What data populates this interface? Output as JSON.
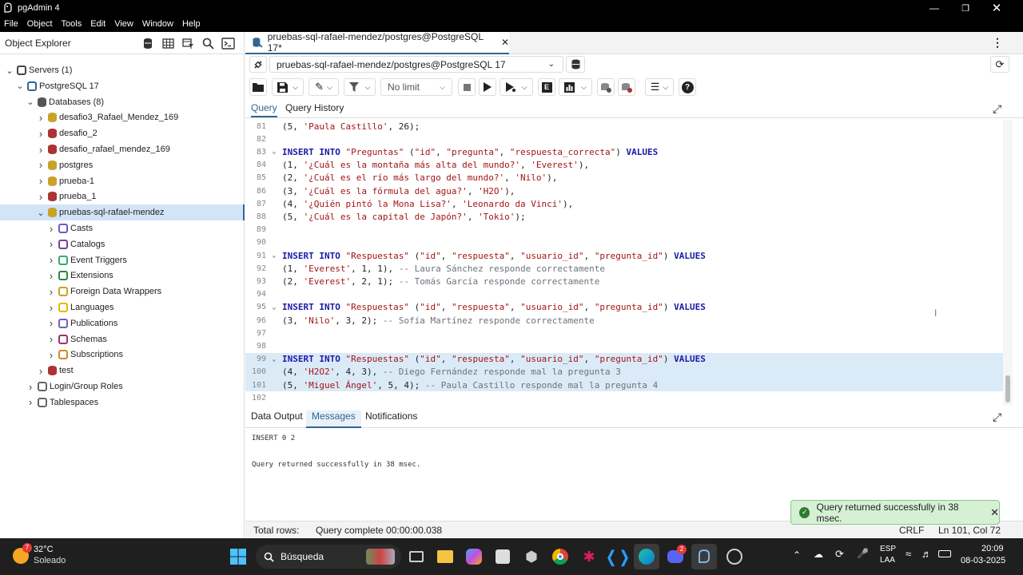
{
  "window": {
    "title": "pgAdmin 4"
  },
  "menu": [
    "File",
    "Object",
    "Tools",
    "Edit",
    "View",
    "Window",
    "Help"
  ],
  "object_explorer": {
    "title": "Object Explorer",
    "tree": [
      {
        "label": "Servers (1)",
        "level": 0,
        "expanded": true,
        "icon": "servers-icon"
      },
      {
        "label": "PostgreSQL 17",
        "level": 1,
        "expanded": true,
        "icon": "server-icon"
      },
      {
        "label": "Databases (8)",
        "level": 2,
        "expanded": true,
        "icon": "databases-icon"
      },
      {
        "label": "desafio3_Rafael_Mendez_169",
        "level": 3,
        "expanded": false,
        "icon": "database-icon"
      },
      {
        "label": "desafio_2",
        "level": 3,
        "expanded": false,
        "icon": "database-disconnected-icon"
      },
      {
        "label": "desafio_rafael_mendez_169",
        "level": 3,
        "expanded": false,
        "icon": "database-disconnected-icon"
      },
      {
        "label": "postgres",
        "level": 3,
        "expanded": false,
        "icon": "database-icon"
      },
      {
        "label": "prueba-1",
        "level": 3,
        "expanded": false,
        "icon": "database-icon"
      },
      {
        "label": "prueba_1",
        "level": 3,
        "expanded": false,
        "icon": "database-disconnected-icon"
      },
      {
        "label": "pruebas-sql-rafael-mendez",
        "level": 3,
        "expanded": true,
        "selected": true,
        "icon": "database-icon"
      },
      {
        "label": "Casts",
        "level": 4,
        "expanded": false,
        "icon": "casts-icon"
      },
      {
        "label": "Catalogs",
        "level": 4,
        "expanded": false,
        "icon": "catalogs-icon"
      },
      {
        "label": "Event Triggers",
        "level": 4,
        "expanded": false,
        "icon": "event-triggers-icon"
      },
      {
        "label": "Extensions",
        "level": 4,
        "expanded": false,
        "icon": "extensions-icon"
      },
      {
        "label": "Foreign Data Wrappers",
        "level": 4,
        "expanded": false,
        "icon": "foreign-data-wrappers-icon"
      },
      {
        "label": "Languages",
        "level": 4,
        "expanded": false,
        "icon": "languages-icon"
      },
      {
        "label": "Publications",
        "level": 4,
        "expanded": false,
        "icon": "publications-icon"
      },
      {
        "label": "Schemas",
        "level": 4,
        "expanded": false,
        "icon": "schemas-icon"
      },
      {
        "label": "Subscriptions",
        "level": 4,
        "expanded": false,
        "icon": "subscriptions-icon"
      },
      {
        "label": "test",
        "level": 3,
        "expanded": false,
        "icon": "database-disconnected-icon"
      },
      {
        "label": "Login/Group Roles",
        "level": 2,
        "expanded": false,
        "icon": "roles-icon"
      },
      {
        "label": "Tablespaces",
        "level": 2,
        "expanded": false,
        "icon": "tablespaces-icon"
      }
    ]
  },
  "query_tool": {
    "tab_label": "pruebas-sql-rafael-mendez/postgres@PostgreSQL 17*",
    "connection": "pruebas-sql-rafael-mendez/postgres@PostgreSQL 17",
    "limit": "No limit",
    "subtabs": [
      "Query",
      "Query History"
    ],
    "lines": [
      {
        "n": "81",
        "fold": false,
        "hl": false,
        "tokens": [
          [
            "p",
            "("
          ],
          [
            "num",
            "5"
          ],
          [
            "p",
            ", "
          ],
          [
            "str",
            "'Paula Castillo'"
          ],
          [
            "p",
            ", "
          ],
          [
            "num",
            "26"
          ],
          [
            "p",
            ");"
          ]
        ]
      },
      {
        "n": "82",
        "fold": false,
        "hl": false,
        "tokens": []
      },
      {
        "n": "83",
        "fold": true,
        "hl": false,
        "tokens": [
          [
            "kw",
            "INSERT INTO "
          ],
          [
            "str",
            "\"Preguntas\""
          ],
          [
            "p",
            " ("
          ],
          [
            "str",
            "\"id\""
          ],
          [
            "p",
            ", "
          ],
          [
            "str",
            "\"pregunta\""
          ],
          [
            "p",
            ", "
          ],
          [
            "str",
            "\"respuesta_correcta\""
          ],
          [
            "p",
            ") "
          ],
          [
            "kw",
            "VALUES"
          ]
        ]
      },
      {
        "n": "84",
        "fold": false,
        "hl": false,
        "tokens": [
          [
            "p",
            "("
          ],
          [
            "num",
            "1"
          ],
          [
            "p",
            ", "
          ],
          [
            "str",
            "'¿Cuál es la montaña más alta del mundo?'"
          ],
          [
            "p",
            ", "
          ],
          [
            "str",
            "'Everest'"
          ],
          [
            "p",
            "),"
          ]
        ]
      },
      {
        "n": "85",
        "fold": false,
        "hl": false,
        "tokens": [
          [
            "p",
            "("
          ],
          [
            "num",
            "2"
          ],
          [
            "p",
            ", "
          ],
          [
            "str",
            "'¿Cuál es el río más largo del mundo?'"
          ],
          [
            "p",
            ", "
          ],
          [
            "str",
            "'Nilo'"
          ],
          [
            "p",
            "),"
          ]
        ]
      },
      {
        "n": "86",
        "fold": false,
        "hl": false,
        "tokens": [
          [
            "p",
            "("
          ],
          [
            "num",
            "3"
          ],
          [
            "p",
            ", "
          ],
          [
            "str",
            "'¿Cuál es la fórmula del agua?'"
          ],
          [
            "p",
            ", "
          ],
          [
            "str",
            "'H2O'"
          ],
          [
            "p",
            "),"
          ]
        ]
      },
      {
        "n": "87",
        "fold": false,
        "hl": false,
        "tokens": [
          [
            "p",
            "("
          ],
          [
            "num",
            "4"
          ],
          [
            "p",
            ", "
          ],
          [
            "str",
            "'¿Quién pintó la Mona Lisa?'"
          ],
          [
            "p",
            ", "
          ],
          [
            "str",
            "'Leonardo da Vinci'"
          ],
          [
            "p",
            "),"
          ]
        ]
      },
      {
        "n": "88",
        "fold": false,
        "hl": false,
        "tokens": [
          [
            "p",
            "("
          ],
          [
            "num",
            "5"
          ],
          [
            "p",
            ", "
          ],
          [
            "str",
            "'¿Cuál es la capital de Japón?'"
          ],
          [
            "p",
            ", "
          ],
          [
            "str",
            "'Tokio'"
          ],
          [
            "p",
            ");"
          ]
        ]
      },
      {
        "n": "89",
        "fold": false,
        "hl": false,
        "tokens": []
      },
      {
        "n": "90",
        "fold": false,
        "hl": false,
        "tokens": []
      },
      {
        "n": "91",
        "fold": true,
        "hl": false,
        "tokens": [
          [
            "kw",
            "INSERT INTO "
          ],
          [
            "str",
            "\"Respuestas\""
          ],
          [
            "p",
            " ("
          ],
          [
            "str",
            "\"id\""
          ],
          [
            "p",
            ", "
          ],
          [
            "str",
            "\"respuesta\""
          ],
          [
            "p",
            ", "
          ],
          [
            "str",
            "\"usuario_id\""
          ],
          [
            "p",
            ", "
          ],
          [
            "str",
            "\"pregunta_id\""
          ],
          [
            "p",
            ") "
          ],
          [
            "kw",
            "VALUES"
          ]
        ]
      },
      {
        "n": "92",
        "fold": false,
        "hl": false,
        "tokens": [
          [
            "p",
            "("
          ],
          [
            "num",
            "1"
          ],
          [
            "p",
            ", "
          ],
          [
            "str",
            "'Everest'"
          ],
          [
            "p",
            ", "
          ],
          [
            "num",
            "1"
          ],
          [
            "p",
            ", "
          ],
          [
            "num",
            "1"
          ],
          [
            "p",
            "), "
          ],
          [
            "cmt",
            "-- Laura Sánchez responde correctamente"
          ]
        ]
      },
      {
        "n": "93",
        "fold": false,
        "hl": false,
        "tokens": [
          [
            "p",
            "("
          ],
          [
            "num",
            "2"
          ],
          [
            "p",
            ", "
          ],
          [
            "str",
            "'Everest'"
          ],
          [
            "p",
            ", "
          ],
          [
            "num",
            "2"
          ],
          [
            "p",
            ", "
          ],
          [
            "num",
            "1"
          ],
          [
            "p",
            "); "
          ],
          [
            "cmt",
            "-- Tomás García responde correctamente"
          ]
        ]
      },
      {
        "n": "94",
        "fold": false,
        "hl": false,
        "tokens": []
      },
      {
        "n": "95",
        "fold": true,
        "hl": false,
        "tokens": [
          [
            "kw",
            "INSERT INTO "
          ],
          [
            "str",
            "\"Respuestas\""
          ],
          [
            "p",
            " ("
          ],
          [
            "str",
            "\"id\""
          ],
          [
            "p",
            ", "
          ],
          [
            "str",
            "\"respuesta\""
          ],
          [
            "p",
            ", "
          ],
          [
            "str",
            "\"usuario_id\""
          ],
          [
            "p",
            ", "
          ],
          [
            "str",
            "\"pregunta_id\""
          ],
          [
            "p",
            ") "
          ],
          [
            "kw",
            "VALUES"
          ]
        ]
      },
      {
        "n": "96",
        "fold": false,
        "hl": false,
        "tokens": [
          [
            "p",
            "("
          ],
          [
            "num",
            "3"
          ],
          [
            "p",
            ", "
          ],
          [
            "str",
            "'Nilo'"
          ],
          [
            "p",
            ", "
          ],
          [
            "num",
            "3"
          ],
          [
            "p",
            ", "
          ],
          [
            "num",
            "2"
          ],
          [
            "p",
            "); "
          ],
          [
            "cmt",
            "-- Sofía Martínez responde correctamente"
          ]
        ]
      },
      {
        "n": "97",
        "fold": false,
        "hl": false,
        "tokens": []
      },
      {
        "n": "98",
        "fold": false,
        "hl": false,
        "tokens": []
      },
      {
        "n": "99",
        "fold": true,
        "hl": true,
        "tokens": [
          [
            "kw",
            "INSERT INTO "
          ],
          [
            "str",
            "\"Respuestas\""
          ],
          [
            "p",
            " ("
          ],
          [
            "str",
            "\"id\""
          ],
          [
            "p",
            ", "
          ],
          [
            "str",
            "\"respuesta\""
          ],
          [
            "p",
            ", "
          ],
          [
            "str",
            "\"usuario_id\""
          ],
          [
            "p",
            ", "
          ],
          [
            "str",
            "\"pregunta_id\""
          ],
          [
            "p",
            ") "
          ],
          [
            "kw",
            "VALUES"
          ]
        ]
      },
      {
        "n": "100",
        "fold": false,
        "hl": true,
        "tokens": [
          [
            "p",
            "("
          ],
          [
            "num",
            "4"
          ],
          [
            "p",
            ", "
          ],
          [
            "str",
            "'H2O2'"
          ],
          [
            "p",
            ", "
          ],
          [
            "num",
            "4"
          ],
          [
            "p",
            ", "
          ],
          [
            "num",
            "3"
          ],
          [
            "p",
            "), "
          ],
          [
            "cmt",
            "-- Diego Fernández responde mal la pregunta 3"
          ]
        ]
      },
      {
        "n": "101",
        "fold": false,
        "hl": true,
        "tokens": [
          [
            "p",
            "("
          ],
          [
            "num",
            "5"
          ],
          [
            "p",
            ", "
          ],
          [
            "str",
            "'Miguel Ángel'"
          ],
          [
            "p",
            ", "
          ],
          [
            "num",
            "5"
          ],
          [
            "p",
            ", "
          ],
          [
            "num",
            "4"
          ],
          [
            "p",
            "); "
          ],
          [
            "cmt",
            "-- Paula Castillo responde mal la pregunta 4"
          ]
        ]
      },
      {
        "n": "102",
        "fold": false,
        "hl": false,
        "tokens": []
      }
    ]
  },
  "output": {
    "tabs": [
      "Data Output",
      "Messages",
      "Notifications"
    ],
    "active_tab": "Messages",
    "messages": [
      "INSERT 0 2",
      "Query returned successfully in 38 msec."
    ]
  },
  "status": {
    "total_rows": "Total rows:",
    "query_complete": "Query complete 00:00:00.038",
    "eol": "CRLF",
    "position": "Ln 101, Col 72"
  },
  "toast": {
    "message": "Query returned successfully in 38 msec."
  },
  "taskbar": {
    "weather_temp": "32°C",
    "weather_desc": "Soleado",
    "weather_badge": "7",
    "search_placeholder": "Búsqueda",
    "lang1": "ESP",
    "lang2": "LAA",
    "time": "20:09",
    "date": "08-03-2025",
    "discord_badge": "2"
  },
  "colors": {
    "accent": "#326690",
    "selected": "#d3e4f7",
    "toast_bg": "#d6f0d4"
  }
}
